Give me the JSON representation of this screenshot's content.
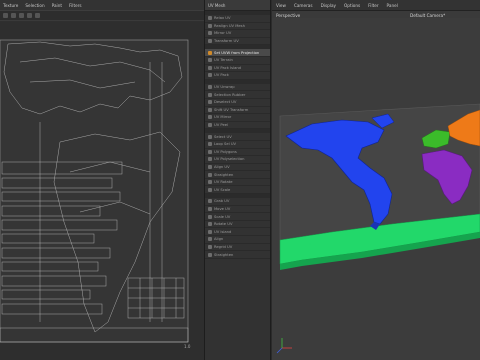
{
  "uv_editor": {
    "menu": [
      "Texture",
      "Selection",
      "Paint",
      "Filters"
    ]
  },
  "object_panel": {
    "header": "UV Mesh",
    "groups": [
      [
        {
          "label": "Relax UV",
          "active": false,
          "icon": "relax-uv-icon"
        },
        {
          "label": "Realign UV Mesh",
          "active": false,
          "icon": "realign-icon"
        },
        {
          "label": "Mirror UV",
          "active": false,
          "icon": "mirror-icon"
        },
        {
          "label": "Transform UV",
          "active": false,
          "icon": "transform-icon"
        }
      ],
      [
        {
          "label": "Set UVW from Projection",
          "active": true,
          "icon": "projection-icon"
        },
        {
          "label": "UV Terrain",
          "active": false,
          "icon": "terrain-icon"
        },
        {
          "label": "UV Pack Island",
          "active": false,
          "icon": "pack-icon"
        },
        {
          "label": "UV Pack",
          "active": false,
          "icon": "pack-icon"
        }
      ],
      [
        {
          "label": "UV Unwrap",
          "active": false,
          "icon": "unwrap-icon"
        },
        {
          "label": "Selection Rubber",
          "active": false,
          "icon": "rubber-icon"
        },
        {
          "label": "Deselect UV",
          "active": false,
          "icon": "deselect-icon"
        },
        {
          "label": "Shift UV Transform",
          "active": false,
          "icon": "shift-icon"
        },
        {
          "label": "UV Mirror",
          "active": false,
          "icon": "mirror-icon"
        },
        {
          "label": "UV Peel",
          "active": false,
          "icon": "peel-icon"
        }
      ],
      [
        {
          "label": "Select UV",
          "active": false,
          "icon": "select-icon"
        },
        {
          "label": "Loop Sel UV",
          "active": false,
          "icon": "loop-icon"
        },
        {
          "label": "UV Polygons",
          "active": false,
          "icon": "polygons-icon"
        },
        {
          "label": "UV Polyselection",
          "active": false,
          "icon": "polyselection-icon"
        },
        {
          "label": "Align UV",
          "active": false,
          "icon": "align-icon"
        },
        {
          "label": "Straighten",
          "active": false,
          "icon": "straighten-icon"
        },
        {
          "label": "UV Rotate",
          "active": false,
          "icon": "rotate-icon"
        },
        {
          "label": "UV Scale",
          "active": false,
          "icon": "scale-icon"
        }
      ],
      [
        {
          "label": "Grab UV",
          "active": false,
          "icon": "grab-icon"
        },
        {
          "label": "Move UV",
          "active": false,
          "icon": "move-icon"
        },
        {
          "label": "Scale UV",
          "active": false,
          "icon": "scale-icon"
        },
        {
          "label": "Rotate UV",
          "active": false,
          "icon": "rotate-icon"
        },
        {
          "label": "UV Island",
          "active": false,
          "icon": "island-icon"
        },
        {
          "label": "Align",
          "active": false,
          "icon": "align-icon"
        },
        {
          "label": "Regrid UV",
          "active": false,
          "icon": "regrid-icon"
        },
        {
          "label": "Straighten",
          "active": false,
          "icon": "straighten-icon"
        }
      ]
    ]
  },
  "viewport": {
    "menu": [
      "View",
      "Cameras",
      "Display",
      "Options",
      "Filter",
      "Panel"
    ],
    "label": "Perspective",
    "camera": "Default Camera*"
  },
  "colors": {
    "americas": "#2244ee",
    "africa": "#8a2cc2",
    "europe": "#3bbb2a",
    "asia": "#ee7a18",
    "antarctica": "#22d86a",
    "uv_lines": "#d6d6d6",
    "accent": "#d08a2a"
  }
}
